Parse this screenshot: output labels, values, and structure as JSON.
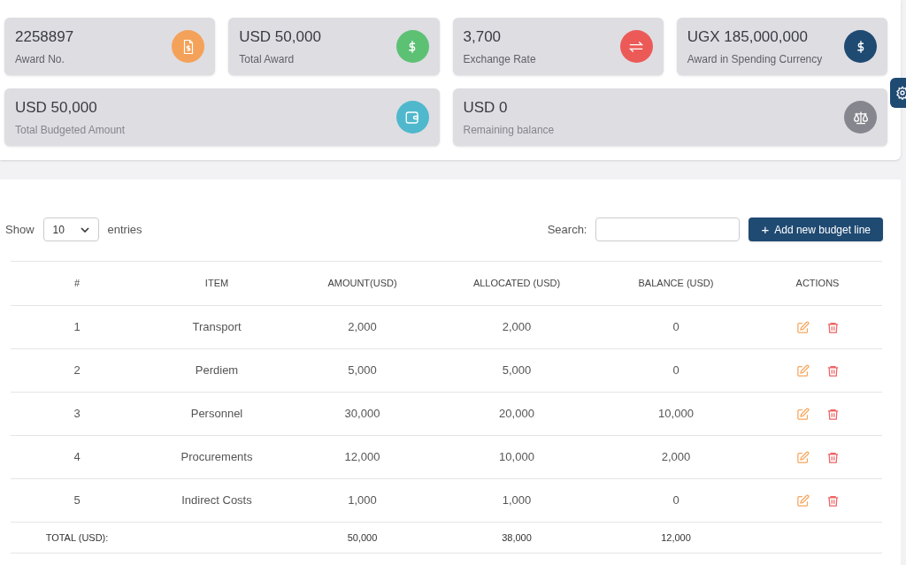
{
  "summary_cards": [
    {
      "value": "2258897",
      "label": "Award No.",
      "kind": "document",
      "color": "#f4a259",
      "wide": false,
      "muted_label": false
    },
    {
      "value": "USD 50,000",
      "label": "Total Award",
      "kind": "dollar",
      "color": "#5dc174",
      "wide": false,
      "muted_label": false
    },
    {
      "value": "3,700",
      "label": "Exchange Rate",
      "kind": "exchange",
      "color": "#ec5a57",
      "wide": false,
      "muted_label": false
    },
    {
      "value": "UGX 185,000,000",
      "label": "Award in Spending Currency",
      "kind": "dollar",
      "color": "#1f4a72",
      "wide": false,
      "muted_label": false
    },
    {
      "value": "USD 50,000",
      "label": "Total Budgeted Amount",
      "kind": "wallet",
      "color": "#4fb8cc",
      "wide": true,
      "muted_label": true
    },
    {
      "value": "USD 0",
      "label": "Remaining balance",
      "kind": "scale",
      "color": "#86868e",
      "wide": true,
      "muted_label": true
    }
  ],
  "length_menu": {
    "prefix": "Show",
    "value": "10",
    "suffix": "entries"
  },
  "search": {
    "label": "Search:"
  },
  "add_button": {
    "icon": "+",
    "label": "Add new budget line"
  },
  "table": {
    "columns": [
      "#",
      "ITEM",
      "AMOUNT(USD)",
      "ALLOCATED (USD)",
      "BALANCE (USD)",
      "ACTIONS"
    ],
    "rows": [
      [
        "1",
        "Transport",
        "2,000",
        "2,000",
        "0"
      ],
      [
        "2",
        "Perdiem",
        "5,000",
        "5,000",
        "0"
      ],
      [
        "3",
        "Personnel",
        "30,000",
        "20,000",
        "10,000"
      ],
      [
        "4",
        "Procurements",
        "12,000",
        "10,000",
        "2,000"
      ],
      [
        "5",
        "Indirect Costs",
        "1,000",
        "1,000",
        "0"
      ]
    ],
    "total": {
      "label": "TOTAL (USD):",
      "amount": "50,000",
      "allocated": "38,000",
      "balance": "12,000"
    }
  }
}
